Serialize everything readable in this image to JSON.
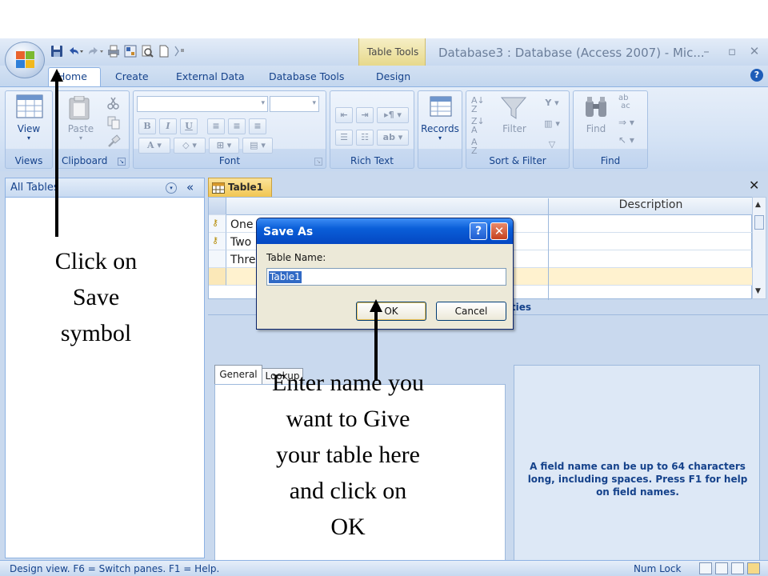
{
  "window": {
    "title": "Database3 : Database (Access 2007) - Mic...",
    "contextual_group": "Table Tools",
    "controls": {
      "minimize": "–",
      "restore": "▫",
      "close": "✕"
    }
  },
  "tabs": [
    {
      "label": "Home"
    },
    {
      "label": "Create"
    },
    {
      "label": "External Data"
    },
    {
      "label": "Database Tools"
    },
    {
      "label": "Design"
    }
  ],
  "ribbon": {
    "groups": {
      "views": "Views",
      "clipboard": "Clipboard",
      "font": "Font",
      "rich_text": "Rich Text",
      "records": "Records",
      "sort_filter": "Sort & Filter",
      "find": "Find"
    },
    "buttons": {
      "view": "View",
      "paste": "Paste",
      "records": "Records",
      "filter": "Filter",
      "find": "Find"
    }
  },
  "nav_pane": {
    "title": "All Tables",
    "dropdown_glyph": "▾",
    "collapse_glyph": "«"
  },
  "document": {
    "tab_label": "Table1",
    "close_glyph": "✕",
    "grid": {
      "columns": [
        "",
        "Description"
      ],
      "rows": [
        {
          "name": "One",
          "key": true
        },
        {
          "name": "Two",
          "key": true
        },
        {
          "name": "Thre",
          "key": false
        }
      ]
    },
    "field_properties": {
      "title": "Field Properties",
      "tabs": [
        "General",
        "Lookup"
      ],
      "help_text": "A field name can be up to 64 characters long, including spaces.  Press F1 for help on field names."
    }
  },
  "status_bar": {
    "text": "Design view.  F6 = Switch panes.  F1 = Help.",
    "num_lock": "Num Lock"
  },
  "dialog": {
    "title": "Save As",
    "label": "Table Name:",
    "value": "Table1",
    "ok": "OK",
    "cancel": "Cancel",
    "help_glyph": "?",
    "close_glyph": "✕"
  },
  "annotations": {
    "save_hint": [
      "Click on",
      "Save",
      "symbol"
    ],
    "name_hint": [
      "Enter name you",
      "want to Give",
      "your table here",
      "and click on",
      "OK"
    ]
  },
  "icons": [
    "office-button-icon",
    "save-icon",
    "undo-icon",
    "redo-icon",
    "print-icon",
    "view-icon",
    "paste-icon",
    "cut-icon",
    "copy-icon",
    "format-painter-icon",
    "records-icon",
    "sort-ascending-icon",
    "sort-descending-icon",
    "filter-icon",
    "find-icon",
    "replace-icon",
    "goto-icon",
    "select-icon",
    "key-icon",
    "help-icon"
  ],
  "colors": {
    "accent": "#15428b",
    "dialog_title": "#0a5ed8",
    "table_tab": "#f1c652"
  }
}
